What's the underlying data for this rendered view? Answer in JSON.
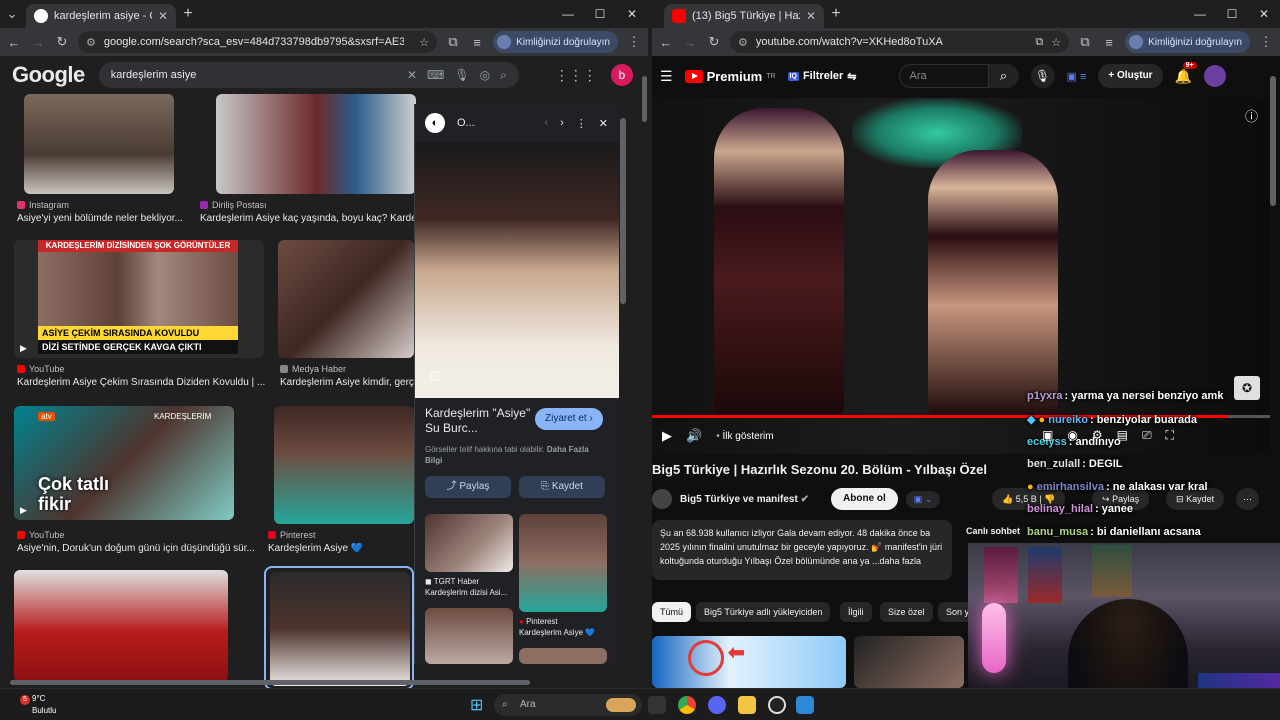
{
  "left_browser": {
    "tab_title": "kardeşlerim asiye - Google'da A...",
    "url": "google.com/search?sca_esv=484d733798db9795&sxsrf=AE3TifOJfOBXc8...",
    "profile_chip": "Kimliğinizi doğrulayın",
    "google": {
      "logo": "Google",
      "query": "kardeşlerim asiye",
      "avatar_letter": "b",
      "results": [
        {
          "source": "Instagram",
          "title": "Asiye'yi yeni bölümde neler bekliyor...",
          "color": "#e1306c"
        },
        {
          "source": "Diriliş Postası",
          "title": "Kardeşlerim Asiye kaç yaşında, boyu kaç? Kardeş",
          "color": "#9c27b0"
        },
        {
          "source": "YouTube",
          "title": "Kardeşlerim Asiye Çekim Sırasında Diziden Kovuldu | ...",
          "color": "#ff0000",
          "thumb_top": "KARDEŞLERİM DİZİSİNDEN ŞOK GÖRÜNTÜLER",
          "thumb_mid": "ASİYE ÇEKİM SIRASINDA KOVULDU",
          "thumb_bot": "DİZİ SETİNDE GERÇEK KAVGA ÇIKTI"
        },
        {
          "source": "Medya Haber",
          "title": "Kardeşlerim Asiye kimdir, gerçe",
          "color": "#888888"
        },
        {
          "source": "YouTube",
          "title": "Asiye'nin, Doruk'un doğum günü için düşündüğü sür...",
          "color": "#ff0000",
          "thumb_text": "Çok tatlı fikir",
          "thumb_brand": "KARDEŞLERİM",
          "thumb_channel": "atv"
        },
        {
          "source": "Pinterest",
          "title": "Kardeşlerim Asiye 💙",
          "color": "#e60023"
        }
      ]
    },
    "panel": {
      "title": "Kardeşlerim \"Asiye\" Su Burc...",
      "site_initial": "O...",
      "visit": "Ziyaret et ›",
      "note_a": "Görseller telif hakkına tabi olabilir.",
      "note_b": "Daha Fazla Bilgi",
      "share": "Paylaş",
      "save": "Kaydet",
      "related": [
        {
          "source": "TGRT Haber",
          "title": "Kardeşlerim dizisi Asi..."
        },
        {
          "source": "Pinterest",
          "title": "Kardeşlerim Asiye 💙"
        }
      ]
    }
  },
  "right_browser": {
    "tab_title": "(13) Big5 Türkiye | Hazırlık S...",
    "url": "youtube.com/watch?v=XKHed8oTuXA",
    "profile_chip": "Kimliğinizi doğrulayın",
    "youtube": {
      "logo": "Premium",
      "logo_sup": "TR",
      "filters": "Filtreler",
      "search_placeholder": "Ara",
      "create": "Oluştur",
      "notif_badge": "9+",
      "player_hint": "İlk gösterim",
      "video_title": "Big5 Türkiye | Hazırlık Sezonu 20. Bölüm - Yılbaşı Özel",
      "channel": "Big5 Türkiye ve manifest",
      "subscribe": "Abone ol",
      "likes": "5,5 B",
      "share": "Paylaş",
      "save": "Kaydet",
      "description": "Şu an 68.938 kullanıcı izliyor  Gala devam ediyor. 48 dakika önce ba 2025 yılının finalini unutulmaz bir geceyle yapıyoruz. 💅 manifest'in jüri koltuğunda oturduğu Yılbaşı Özel bölümünde ana ya ...daha fazla",
      "live_chat_label": "Canlı sohbet",
      "chips": [
        "Tümü",
        "Big5 Türkiye adlı yükleyiciden",
        "İlgili",
        "Size özel",
        "Son y"
      ]
    },
    "chat_overlay": [
      {
        "user": "p1yxra",
        "msg": ": yarma ya nersei benziyo amk",
        "color": "#b39ddb"
      },
      {
        "user": "nureiko",
        "msg": ": benziyolar buarada",
        "color": "#64b5f6"
      },
      {
        "user": "ecelyss",
        "msg": ": andınıyo",
        "color": "#4dd0e1"
      },
      {
        "user": "ben_zulall",
        "msg": ": DEGIL",
        "color": "#e0e0e0"
      },
      {
        "user": "emirhansilva",
        "msg": ": ne alakası var kral",
        "color": "#7986cb"
      },
      {
        "user": "belinay_hilal",
        "msg": ": yanee",
        "color": "#ce93d8"
      },
      {
        "user": "banu_musa",
        "msg": ": bi daniellanı acsana",
        "color": "#aed581"
      }
    ]
  },
  "taskbar": {
    "temp": "9°C",
    "condition": "Bulutlu",
    "alert_count": "5",
    "search": "Ara"
  }
}
